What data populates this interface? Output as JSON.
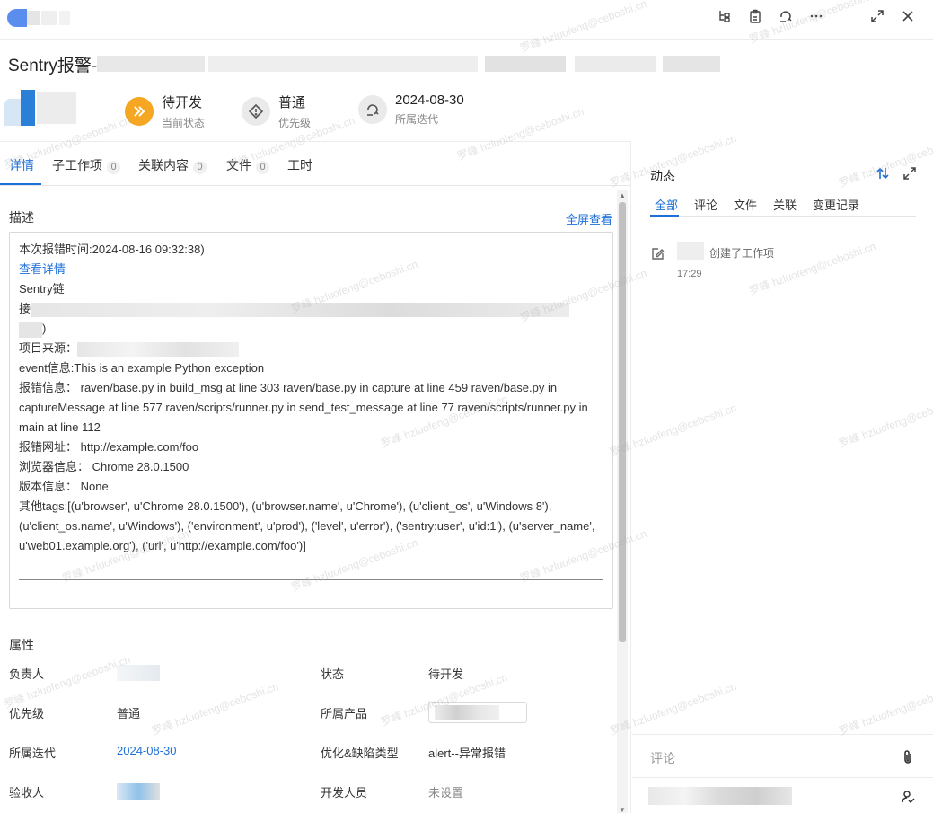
{
  "title": {
    "text": "Sentry报警-"
  },
  "meta": [
    {
      "value": "待开发",
      "label": "当前状态",
      "icon": "double-arrow-right-icon",
      "color": "#f5a623"
    },
    {
      "value": "普通",
      "label": "优先级",
      "icon": "priority-diamond-icon",
      "color": "#555"
    },
    {
      "value": "2024-08-30",
      "label": "所属迭代",
      "icon": "iteration-cycle-icon",
      "color": "#555"
    }
  ],
  "tabs": {
    "details": "详情",
    "subitems": {
      "label": "子工作项",
      "count": "0"
    },
    "related": {
      "label": "关联内容",
      "count": "0"
    },
    "files": {
      "label": "文件",
      "count": "0"
    },
    "worktime": "工时"
  },
  "description": {
    "heading": "描述",
    "fullscreen": "全屏查看",
    "lines": {
      "time": "本次报错时间:2024-08-16 09:32:38)",
      "detail_link": "查看详情",
      "sentry_link": "Sentry链",
      "link_prefix": "接",
      "link_suffix": ")",
      "source": "项目来源：",
      "event": "event信息:This is an example Python exception",
      "error_info": "报错信息：  raven/base.py in build_msg at line 303 raven/base.py in capture at line 459 raven/base.py in captureMessage at line 577 raven/scripts/runner.py in send_test_message at line 77 raven/scripts/runner.py in main at line 112",
      "url": "报错网址：  http://example.com/foo",
      "browser": "浏览器信息：  Chrome 28.0.1500",
      "version": "版本信息：  None",
      "tags": "其他tags:[(u'browser', u'Chrome 28.0.1500'), (u'browser.name', u'Chrome'), (u'client_os', u'Windows 8'), (u'client_os.name', u'Windows'), ('environment', u'prod'), ('level', u'error'), ('sentry:user', u'id:1'), (u'server_name', u'web01.example.org'), ('url', u'http://example.com/foo')]"
    }
  },
  "properties": {
    "heading": "属性",
    "assignee_label": "负责人",
    "status_label": "状态",
    "status_value": "待开发",
    "priority_label": "优先级",
    "priority_value": "普通",
    "product_label": "所属产品",
    "iteration_label": "所属迭代",
    "iteration_value": "2024-08-30",
    "defect_type_label": "优化&缺陷类型",
    "defect_type_value": "alert--异常报错",
    "acceptor_label": "验收人",
    "developer_label": "开发人员",
    "developer_value": "未设置"
  },
  "activity": {
    "title": "动态",
    "tabs": [
      "全部",
      "评论",
      "文件",
      "关联",
      "变更记录"
    ],
    "items": [
      {
        "text": "创建了工作项",
        "time": "17:29"
      }
    ]
  },
  "comment": {
    "placeholder": "评论"
  },
  "watermark": "罗峰 hzluofeng@ceboshi.cn",
  "colors": {
    "accent": "#1e6fd9",
    "status": "#f5a623"
  }
}
